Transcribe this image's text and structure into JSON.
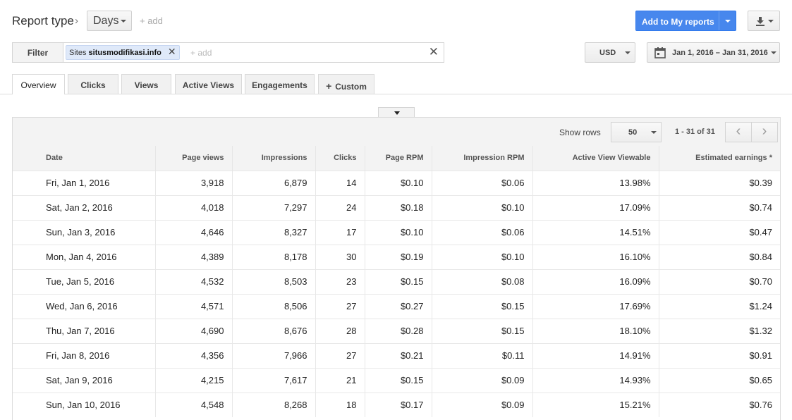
{
  "header": {
    "report_type_label": "Report type",
    "days_label": "Days",
    "add_label": "+ add",
    "add_to_reports_label": "Add to My reports"
  },
  "filter": {
    "label": "Filter",
    "chip_prefix": "Sites",
    "chip_value": "situsmodifikasi.info",
    "add_placeholder": "+ add"
  },
  "currency": {
    "selected": "USD"
  },
  "date_range": {
    "label": "Jan 1, 2016 – Jan 31, 2016"
  },
  "tabs": [
    {
      "label": "Overview",
      "active": true
    },
    {
      "label": "Clicks"
    },
    {
      "label": "Views"
    },
    {
      "label": "Active Views"
    },
    {
      "label": "Engagements"
    },
    {
      "label": "Custom"
    }
  ],
  "table": {
    "show_rows_label": "Show rows",
    "rows_per_page": "50",
    "page_info": "1 - 31 of 31",
    "columns": [
      "Date",
      "Page views",
      "Impressions",
      "Clicks",
      "Page RPM",
      "Impression RPM",
      "Active View Viewable",
      "Estimated earnings *"
    ],
    "rows": [
      [
        "Fri, Jan 1, 2016",
        "3,918",
        "6,879",
        "14",
        "$0.10",
        "$0.06",
        "13.98%",
        "$0.39"
      ],
      [
        "Sat, Jan 2, 2016",
        "4,018",
        "7,297",
        "24",
        "$0.18",
        "$0.10",
        "17.09%",
        "$0.74"
      ],
      [
        "Sun, Jan 3, 2016",
        "4,646",
        "8,327",
        "17",
        "$0.10",
        "$0.06",
        "14.51%",
        "$0.47"
      ],
      [
        "Mon, Jan 4, 2016",
        "4,389",
        "8,178",
        "30",
        "$0.19",
        "$0.10",
        "16.10%",
        "$0.84"
      ],
      [
        "Tue, Jan 5, 2016",
        "4,532",
        "8,503",
        "23",
        "$0.15",
        "$0.08",
        "16.09%",
        "$0.70"
      ],
      [
        "Wed, Jan 6, 2016",
        "4,571",
        "8,506",
        "27",
        "$0.27",
        "$0.15",
        "17.69%",
        "$1.24"
      ],
      [
        "Thu, Jan 7, 2016",
        "4,690",
        "8,676",
        "28",
        "$0.28",
        "$0.15",
        "18.10%",
        "$1.32"
      ],
      [
        "Fri, Jan 8, 2016",
        "4,356",
        "7,966",
        "27",
        "$0.21",
        "$0.11",
        "14.91%",
        "$0.91"
      ],
      [
        "Sat, Jan 9, 2016",
        "4,215",
        "7,617",
        "21",
        "$0.15",
        "$0.09",
        "14.93%",
        "$0.65"
      ],
      [
        "Sun, Jan 10, 2016",
        "4,548",
        "8,268",
        "18",
        "$0.17",
        "$0.09",
        "15.21%",
        "$0.76"
      ]
    ]
  },
  "colors": {
    "accent": "#4787ed"
  }
}
